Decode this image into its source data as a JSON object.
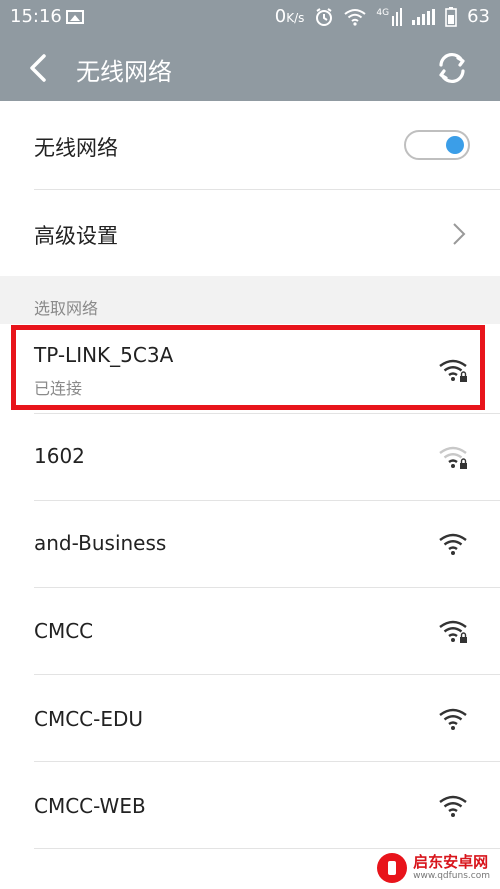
{
  "status_bar": {
    "time": "15:16",
    "net_speed_value": "0",
    "net_speed_unit": "K/s",
    "network_type": "4G",
    "battery": "63"
  },
  "app_bar": {
    "title": "无线网络"
  },
  "wifi_toggle": {
    "label": "无线网络",
    "on": true
  },
  "advanced": {
    "label": "高级设置"
  },
  "section": {
    "title": "选取网络"
  },
  "networks": [
    {
      "name": "TP-LINK_5C3A",
      "status": "已连接",
      "secured": true,
      "signal": "strong"
    },
    {
      "name": "1602",
      "secured": true,
      "signal": "weak"
    },
    {
      "name": "and-Business",
      "secured": false,
      "signal": "strong"
    },
    {
      "name": "CMCC",
      "secured": true,
      "signal": "strong"
    },
    {
      "name": "CMCC-EDU",
      "secured": false,
      "signal": "strong"
    },
    {
      "name": "CMCC-WEB",
      "secured": false,
      "signal": "strong"
    }
  ],
  "watermark": {
    "title": "启东安卓网",
    "url": "www.qdfuns.com"
  },
  "colors": {
    "header": "#909aa1",
    "accent": "#3b9ee8",
    "highlight": "#e8141b"
  }
}
